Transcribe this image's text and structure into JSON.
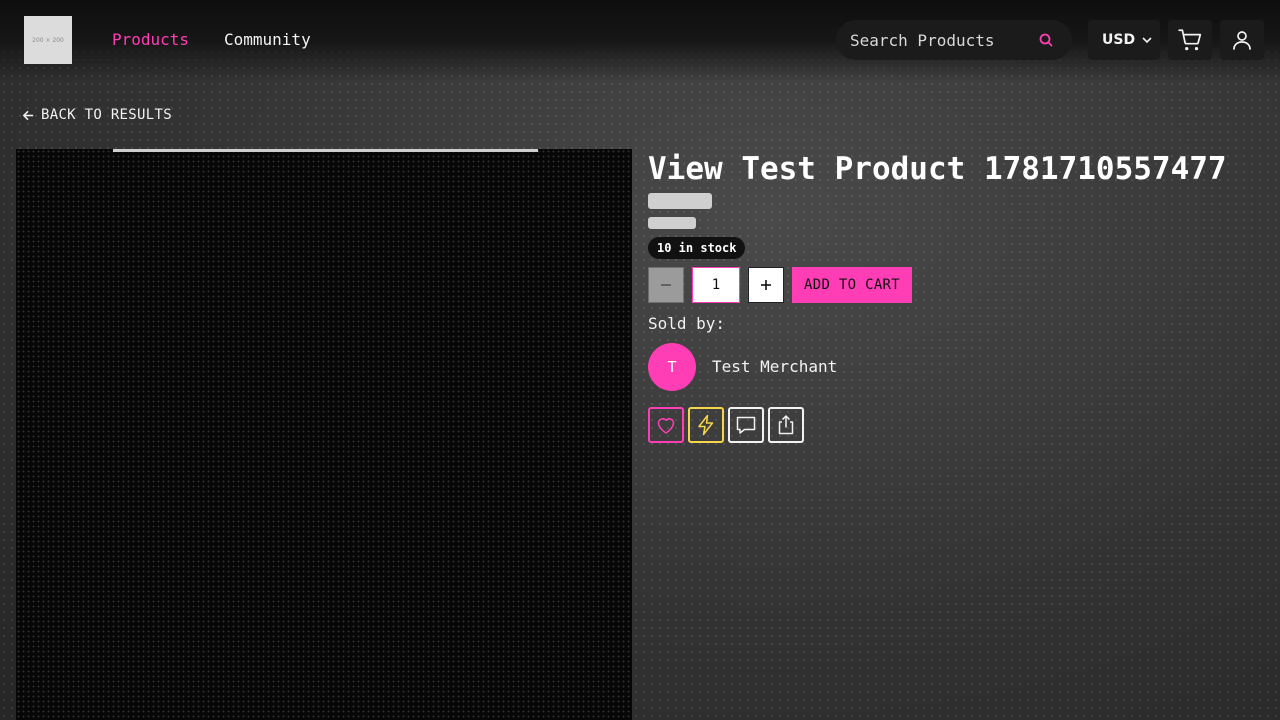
{
  "header": {
    "logo_text": "200 × 200",
    "nav": [
      {
        "label": "Products",
        "active": true
      },
      {
        "label": "Community",
        "active": false
      }
    ],
    "search": {
      "placeholder": "Search Products",
      "value": ""
    },
    "currency": "USD",
    "icons": {
      "search": "search-icon",
      "currency": "chevron-down-icon",
      "cart": "cart-icon",
      "account": "user-icon"
    }
  },
  "back_link": {
    "label": "BACK TO RESULTS",
    "icon": "arrow-left-icon"
  },
  "gallery": {
    "progress_percent": 69
  },
  "product": {
    "title": "View Test Product 1781710557477",
    "stock_label": "10 in stock",
    "quantity": "1",
    "add_to_cart_label": "ADD TO CART",
    "sold_by_label": "Sold by:",
    "merchant": {
      "initial": "T",
      "name": "Test Merchant"
    }
  },
  "actions": [
    {
      "name": "favorite",
      "icon": "heart-icon"
    },
    {
      "name": "boost",
      "icon": "lightning-icon"
    },
    {
      "name": "comment",
      "icon": "chat-icon"
    },
    {
      "name": "share",
      "icon": "share-icon"
    }
  ],
  "colors": {
    "accent": "#ff3eb5",
    "boost": "#f5d64a",
    "header_bg": "#0e0e0e"
  }
}
